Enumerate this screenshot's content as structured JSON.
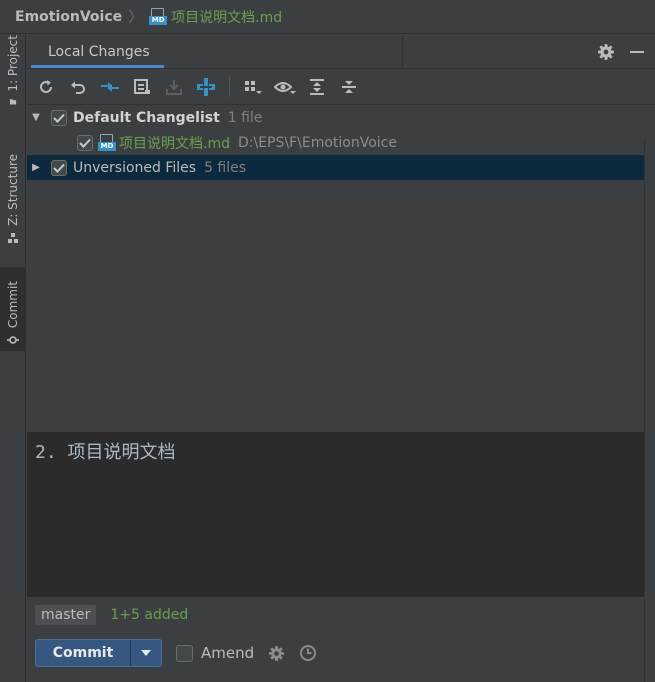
{
  "breadcrumb": {
    "project": "EmotionVoice",
    "file": "项目说明文档.md",
    "file_icon": "markdown-file-icon",
    "md_tag": "MD"
  },
  "toolwindows": [
    {
      "label": "1: Project",
      "icon": "folder-icon"
    },
    {
      "label": "Z: Structure",
      "icon": "structure-icon"
    },
    {
      "label": "Commit",
      "icon": "commit-icon",
      "active": true
    }
  ],
  "tabs": [
    {
      "label": "Local Changes",
      "active": true
    }
  ],
  "tab_actions": [
    "gear-icon",
    "minimize-icon"
  ],
  "toolbar": [
    "refresh-icon",
    "rollback-icon",
    "show-diff-icon",
    "changelist-icon",
    "shelve-icon",
    "update-icon",
    "group-by-icon",
    "view-options-icon",
    "expand-all-icon",
    "collapse-all-icon"
  ],
  "tree": {
    "changelist": {
      "name": "Default Changelist",
      "count": "1 file",
      "checked": true,
      "expanded": true
    },
    "files": [
      {
        "name": "项目说明文档.md",
        "path": "D:\\EPS\\F\\EmotionVoice",
        "checked": true
      }
    ],
    "unversioned": {
      "name": "Unversioned Files",
      "count": "5 files",
      "checked": true,
      "expanded": false,
      "selected": true
    }
  },
  "commit_message": "2. 项目说明文档",
  "status": {
    "branch": "master",
    "changes": "1+5 added"
  },
  "actions": {
    "commit_label": "Commit",
    "amend_label": "Amend",
    "amend_checked": false
  },
  "colors": {
    "accent": "#4a88c7",
    "added_green": "#6a9f4e",
    "selection": "#0d293e",
    "button": "#365880"
  }
}
